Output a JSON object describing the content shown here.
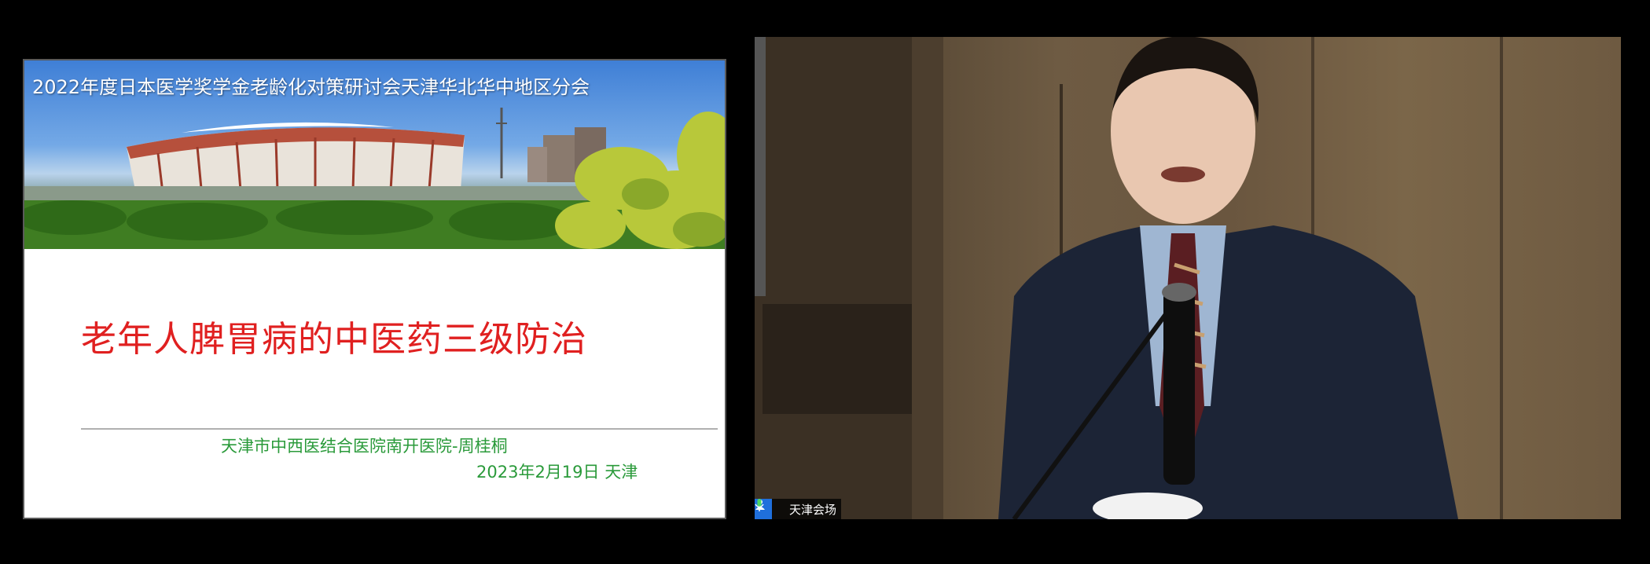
{
  "slide": {
    "conference_title": "2022年度日本医学奖学金老龄化对策研讨会天津华北华中地区分会",
    "main_title": "老年人脾胃病的中医药三级防治",
    "author": "天津市中西医结合医院南开医院-周桂桐",
    "date_location": "2023年2月19日  天津",
    "colors": {
      "title": "#e02020",
      "subtitle": "#2a9a3a"
    }
  },
  "video": {
    "participant_name": "天津会场",
    "icons": [
      "user-icon",
      "microphone-icon"
    ],
    "accent": "#1f6fdc"
  }
}
